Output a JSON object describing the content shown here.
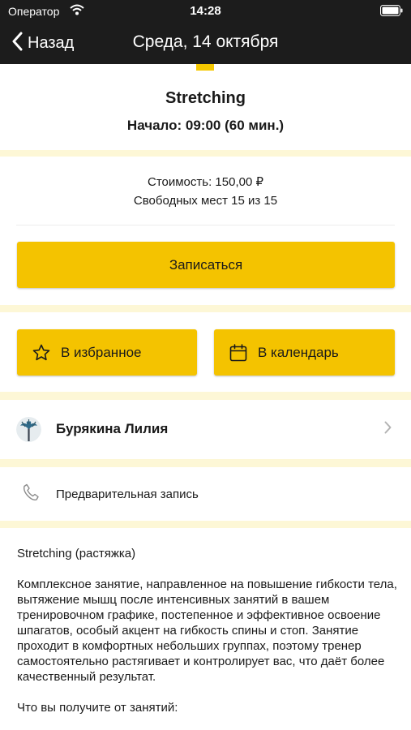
{
  "status_bar": {
    "carrier": "Оператор",
    "time": "14:28"
  },
  "nav": {
    "back_label": "Назад",
    "title": "Среда, 14 октября"
  },
  "class_info": {
    "title": "Stretching",
    "start": "Начало: 09:00 (60 мин.)",
    "price": "Стоимость: 150,00 ₽",
    "seats": "Свободных мест 15 из 15"
  },
  "actions": {
    "signup_label": "Записаться",
    "favorite_label": "В избранное",
    "calendar_label": "В календарь"
  },
  "trainer": {
    "name": "Бурякина Лилия"
  },
  "booking": {
    "label": "Предварительная запись"
  },
  "description": {
    "heading": "Stretching (растяжка)",
    "body": "Комплексное занятие, направленное на повышение гибкости тела, вытяжение мышц после интенсивных занятий в вашем тренировочном графике, постепенное и эффективное освоение шпагатов, особый акцент на гибкость спины и стоп. Занятие проходит в комфортных небольших группах, поэтому тренер самостоятельно растягивает и контролирует вас, что даёт более качественный результат.",
    "subheading": "Что вы получите от занятий:"
  },
  "colors": {
    "header_bg": "#1c1c1c",
    "accent_yellow": "#f4c300",
    "band_bg": "#fdf7d6"
  },
  "icons": {
    "back": "chevron-left-icon",
    "favorite": "star-icon",
    "calendar": "calendar-icon",
    "phone": "phone-icon",
    "disclosure": "chevron-right-icon"
  }
}
